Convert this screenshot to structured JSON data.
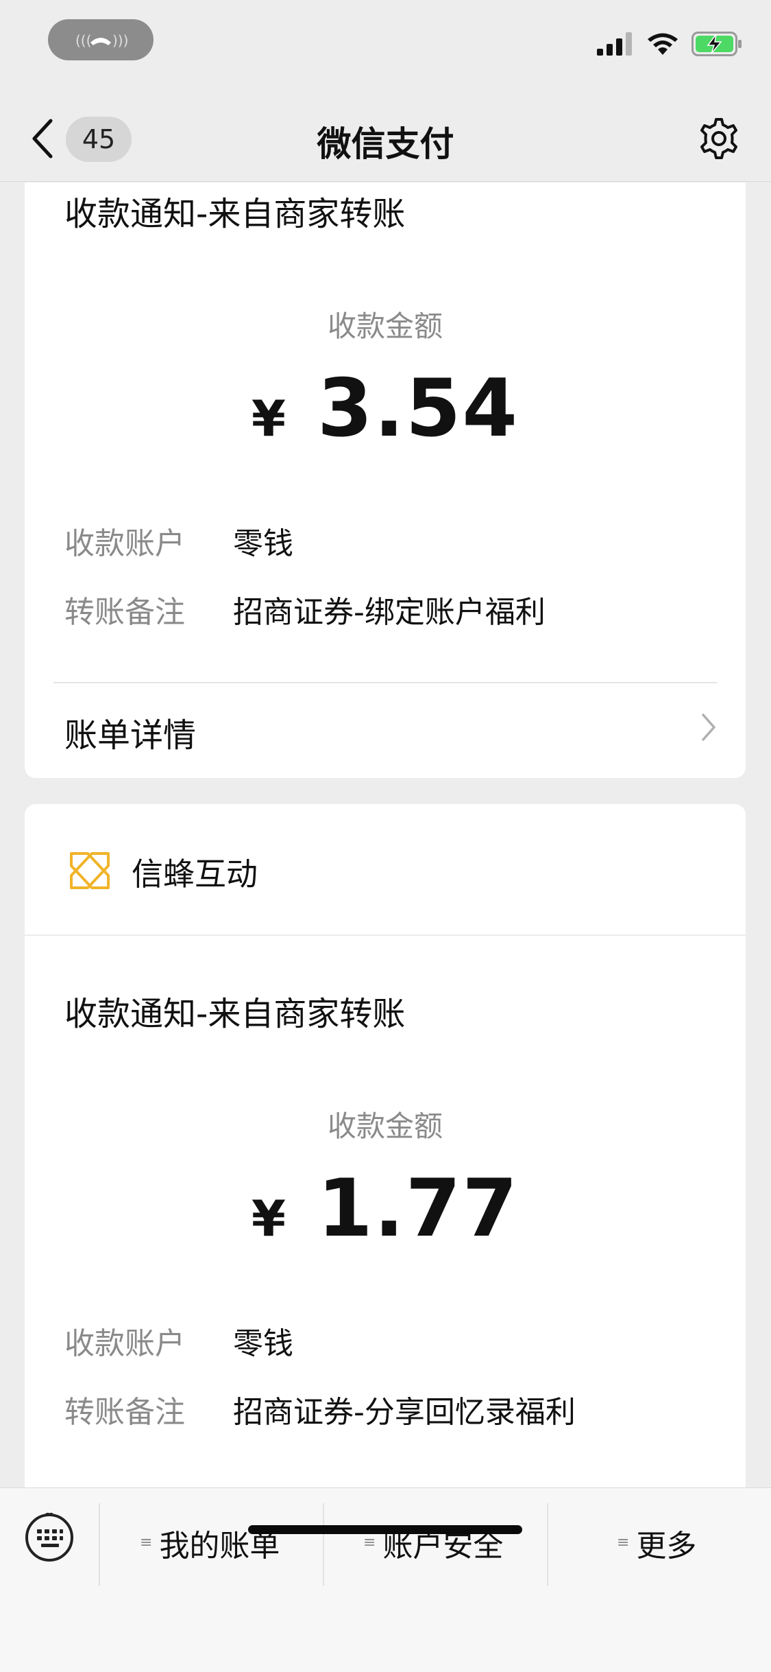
{
  "status_bar": {
    "call_icon": "phone-call-icon",
    "signal_icon": "cellular-signal-icon",
    "wifi_icon": "wifi-icon",
    "battery_icon": "battery-charging-icon",
    "colors": {
      "battery": "#4cd964",
      "call_pill": "#8c8c8c"
    }
  },
  "nav": {
    "back_icon": "chevron-left-icon",
    "unread_count": "45",
    "title": "微信支付",
    "settings_icon": "gear-icon"
  },
  "messages": [
    {
      "title": "收款通知-来自商家转账",
      "amount_label": "收款金额",
      "currency": "¥",
      "amount": "3.54",
      "fields": [
        {
          "key": "收款账户",
          "value": "零钱"
        },
        {
          "key": "转账备注",
          "value": "招商证券-绑定账户福利"
        }
      ],
      "detail_label": "账单详情"
    },
    {
      "merchant": "信蜂互动",
      "title": "收款通知-来自商家转账",
      "amount_label": "收款金额",
      "currency": "¥",
      "amount": "1.77",
      "fields": [
        {
          "key": "收款账户",
          "value": "零钱"
        },
        {
          "key": "转账备注",
          "value": "招商证券-分享回忆录福利"
        }
      ]
    }
  ],
  "bottom_menu": {
    "keyboard_icon": "keyboard-icon",
    "items": [
      {
        "label": "我的账单"
      },
      {
        "label": "账户安全"
      },
      {
        "label": "更多"
      }
    ],
    "menu_icon_glyph": "≡"
  }
}
